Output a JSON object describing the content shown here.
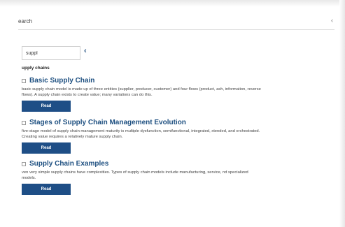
{
  "search": {
    "label": "earch",
    "caret": "‹"
  },
  "filter": {
    "value": "suppl",
    "chevron": "‹"
  },
  "category": {
    "label": "upply chains"
  },
  "results": [
    {
      "title": "Basic Supply Chain",
      "description": "basic supply chain model is made up of three entities (supplier, producer, customer) and four flows (product, ash, information, reverse flows). A supply chain exists to create value; many variations can do this.",
      "button": "Read"
    },
    {
      "title": "Stages of Supply Chain Management Evolution",
      "description": "five-stage model of supply chain management maturity is multiple dysfunction, semifunctional, integrated, xtended, and orchestrated. Creating value requires a relatively mature supply chain.",
      "button": "Read"
    },
    {
      "title": "Supply Chain Examples",
      "description": "ven very simple supply chains have complexities. Types of supply chain models include manufacturing, service, nd specialized models.",
      "button": "Read"
    }
  ]
}
